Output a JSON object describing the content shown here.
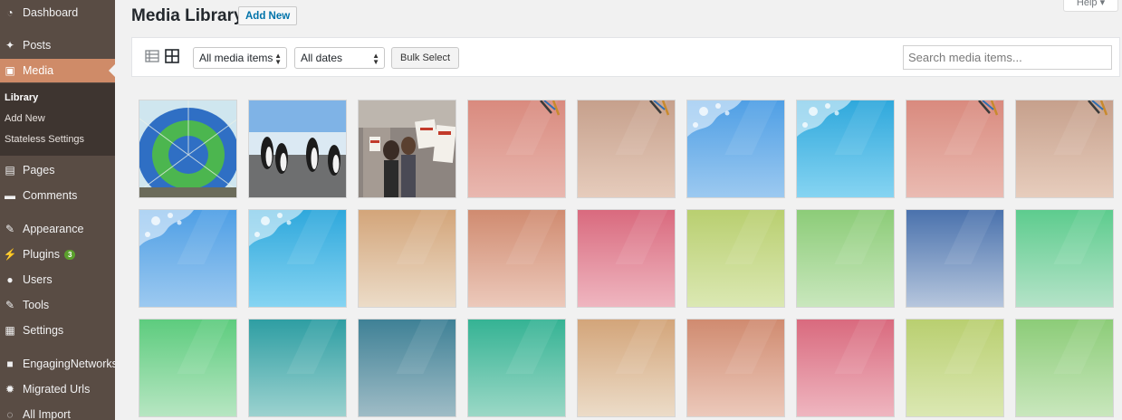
{
  "sidebar": {
    "items": [
      {
        "label": "Dashboard",
        "icon": "dashboard-icon",
        "top": 0
      },
      {
        "label": "Posts",
        "icon": "pushpin-icon"
      },
      {
        "label": "Media",
        "icon": "media-icon",
        "active": true
      },
      {
        "label": "Pages",
        "icon": "pages-icon"
      },
      {
        "label": "Comments",
        "icon": "comments-icon"
      },
      {
        "label": "Appearance",
        "icon": "brush-icon"
      },
      {
        "label": "Plugins",
        "icon": "plugin-icon",
        "badge": "3"
      },
      {
        "label": "Users",
        "icon": "users-icon"
      },
      {
        "label": "Tools",
        "icon": "wrench-icon"
      },
      {
        "label": "Settings",
        "icon": "settings-icon"
      },
      {
        "label": "EngagingNetworks",
        "icon": "en-icon"
      },
      {
        "label": "Migrated Urls",
        "icon": "gear-icon"
      },
      {
        "label": "All Import",
        "icon": "import-icon"
      }
    ],
    "submenu": [
      {
        "label": "Library",
        "current": true
      },
      {
        "label": "Add New"
      },
      {
        "label": "Stateless Settings"
      }
    ]
  },
  "header": {
    "title": "Media Library",
    "add_new": "Add New",
    "help": "Help ▾"
  },
  "toolbar": {
    "filter_type": "All media items",
    "filter_date": "All dates",
    "bulk_select": "Bulk Select",
    "search_placeholder": "Search media items..."
  },
  "colors": {
    "accent": "#cf8b68",
    "sidebar": "#594c44",
    "link": "#0073aa"
  },
  "media_grid": [
    [
      {
        "kind": "photo",
        "subject": "balloon",
        "from": "#3c9ad8",
        "to": "#3aa86b"
      },
      {
        "kind": "photo",
        "subject": "penguins",
        "from": "#6fa8dc",
        "to": "#8a8f93"
      },
      {
        "kind": "photo",
        "subject": "protest",
        "from": "#7a6a62",
        "to": "#c7bdb5"
      },
      {
        "kind": "gradient",
        "from": "#d98a7e",
        "to": "#e9b8b0",
        "deco": "pens"
      },
      {
        "kind": "gradient",
        "from": "#c6a08c",
        "to": "#e6ccbc",
        "deco": "pens"
      },
      {
        "kind": "gradient",
        "from": "#4f9fe5",
        "to": "#9cc9f0",
        "deco": "splash"
      },
      {
        "kind": "gradient",
        "from": "#2fa8dc",
        "to": "#86d4f2",
        "deco": "splash"
      },
      {
        "kind": "gradient",
        "from": "#d98a7e",
        "to": "#eabbb2",
        "deco": "pens"
      },
      {
        "kind": "gradient",
        "from": "#c6a08c",
        "to": "#e7cdbd",
        "deco": "pens"
      }
    ],
    [
      {
        "kind": "gradient",
        "from": "#4f9fe5",
        "to": "#9cc9f0",
        "deco": "splash"
      },
      {
        "kind": "gradient",
        "from": "#2fa8dc",
        "to": "#86d4f2",
        "deco": "splash"
      },
      {
        "kind": "gradient",
        "from": "#d3a57a",
        "to": "#ecdcc8"
      },
      {
        "kind": "gradient",
        "from": "#d08b70",
        "to": "#ecc9bb"
      },
      {
        "kind": "gradient",
        "from": "#d96a7e",
        "to": "#efb6c0"
      },
      {
        "kind": "gradient",
        "from": "#b9cf70",
        "to": "#dbe8b3"
      },
      {
        "kind": "gradient",
        "from": "#8ccc78",
        "to": "#c9e7bd"
      },
      {
        "kind": "gradient",
        "from": "#4a72ad",
        "to": "#b6c6dd"
      },
      {
        "kind": "gradient",
        "from": "#5dcc8e",
        "to": "#b5e3c8"
      }
    ],
    [
      {
        "kind": "gradient",
        "from": "#5dcc7e",
        "to": "#b7e6c2"
      },
      {
        "kind": "gradient",
        "from": "#2e9ea3",
        "to": "#9cd2cf"
      },
      {
        "kind": "gradient",
        "from": "#3f8196",
        "to": "#9fbcc6"
      },
      {
        "kind": "gradient",
        "from": "#35b394",
        "to": "#9bd8c6"
      },
      {
        "kind": "gradient",
        "from": "#d3a57a",
        "to": "#ecdcc8"
      },
      {
        "kind": "gradient",
        "from": "#d08b70",
        "to": "#ecc9bb"
      },
      {
        "kind": "gradient",
        "from": "#d96a7e",
        "to": "#efb6c0"
      },
      {
        "kind": "gradient",
        "from": "#b9cf70",
        "to": "#dbe8b3"
      },
      {
        "kind": "gradient",
        "from": "#8ccc78",
        "to": "#c9e7bd"
      }
    ]
  ]
}
